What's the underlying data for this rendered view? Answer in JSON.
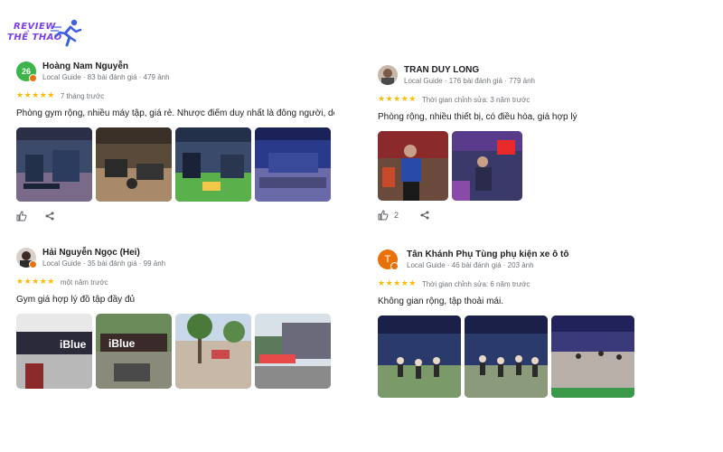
{
  "logo": {
    "line1": "REVIEW",
    "line2": "THỂ THAO"
  },
  "reviews": [
    {
      "name": "Hoàng Nam Nguyễn",
      "meta": "Local Guide · 83 bài đánh giá · 479 ảnh",
      "avatar_letter": "26",
      "avatar_color": "#3bb54a",
      "stars": "★★★★★",
      "time": "7 tháng trước",
      "text": "Phòng gym rộng, nhiều máy tập, giá rẻ. Nhược điểm duy nhất là đông người, dễ bị hơn"
    },
    {
      "name": "TRAN DUY LONG",
      "meta": "Local Guide · 176 bài đánh giá · 779 ảnh",
      "stars": "★★★★★",
      "time": "Thời gian chỉnh sửa: 3 năm trước",
      "text": "Phòng rộng, nhiều thiết bị, có điều hòa, giá hợp lý",
      "likes": "2"
    },
    {
      "name": "Hải Nguyễn Ngọc (Hei)",
      "meta": "Local Guide · 35 bài đánh giá · 99 ảnh",
      "stars": "★★★★★",
      "time": "một năm trước",
      "text": "Gym giá hợp lý đồ tập đầy đủ",
      "photo_sign": "iBlue"
    },
    {
      "name": "Tân Khánh Phụ Tùng phụ kiện xe ô tô",
      "meta": "Local Guide · 46 bài đánh giá · 203 ảnh",
      "avatar_letter": "T",
      "avatar_color": "#e8710a",
      "stars": "★★★★★",
      "time": "Thời gian chỉnh sửa: 6 năm trước",
      "text": "Không gian rộng, tập thoải mái."
    }
  ]
}
